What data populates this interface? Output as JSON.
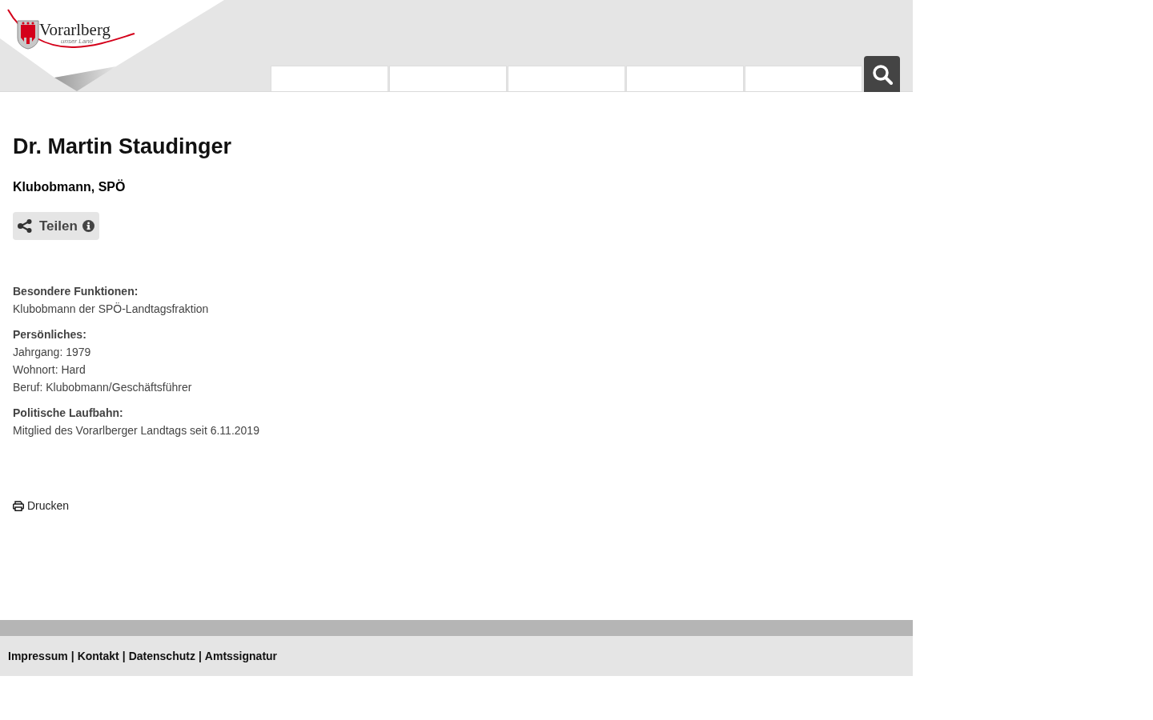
{
  "header": {
    "logo": {
      "title": "Vorarlberg",
      "subtitle": "unser Land"
    }
  },
  "person": {
    "name": "Dr. Martin Staudinger",
    "role": "Klubobmann, SPÖ"
  },
  "share_button": {
    "label": "Teilen"
  },
  "sections": [
    {
      "heading": "Besondere Funktionen:",
      "lines": [
        "Klubobmann der SPÖ-Landtagsfraktion"
      ]
    },
    {
      "heading": "Persönliches:",
      "lines": [
        "Jahrgang: 1979",
        "Wohnort: Hard",
        "Beruf: Klubobmann/Geschäftsführer"
      ]
    },
    {
      "heading": "Politische Laufbahn:",
      "lines": [
        "Mitglied des Vorarlberger Landtags seit 6.11.2019"
      ]
    }
  ],
  "print_link": {
    "label": "Drucken"
  },
  "footer": {
    "links": [
      "Impressum",
      "Kontakt",
      "Datenschutz",
      "Amtssignatur"
    ],
    "separators": [
      "|",
      "|",
      "|"
    ]
  }
}
